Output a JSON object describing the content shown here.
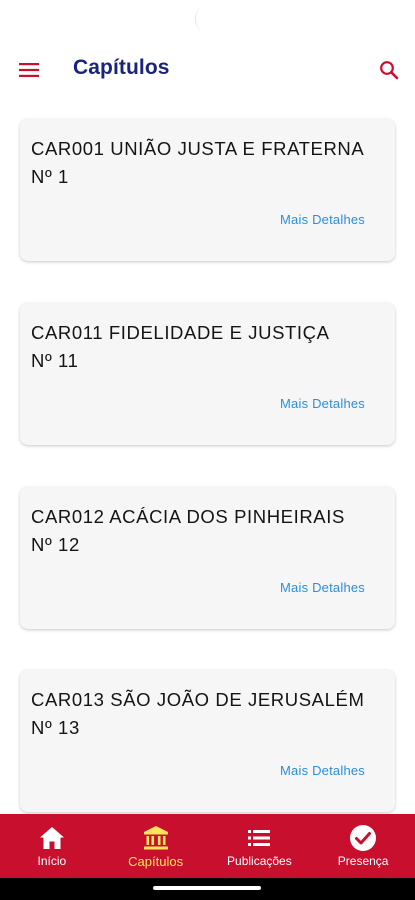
{
  "app_bar": {
    "title": "Capítulos",
    "menu_icon": "hamburger-menu-icon",
    "search_icon": "search-icon",
    "accent_color": "#c8102e",
    "title_color": "#1a237e"
  },
  "chapters": [
    {
      "title_line1": "CAR001 UNIÃO JUSTA E FRATERNA",
      "title_line2": "Nº 1",
      "details_label": "Mais Detalhes"
    },
    {
      "title_line1": "CAR011 FIDELIDADE E JUSTIÇA",
      "title_line2": "Nº 11",
      "details_label": "Mais Detalhes"
    },
    {
      "title_line1": "CAR012 ACÁCIA DOS PINHEIRAIS",
      "title_line2": "Nº 12",
      "details_label": "Mais Detalhes"
    },
    {
      "title_line1": "CAR013 SÃO JOÃO DE JERUSALÉM",
      "title_line2": "Nº 13",
      "details_label": "Mais Detalhes"
    }
  ],
  "bottom_nav": {
    "background": "#c8102e",
    "active_color": "#ffe45c",
    "items": [
      {
        "label": "Início",
        "icon": "home-icon",
        "active": false
      },
      {
        "label": "Capítulos",
        "icon": "institution-icon",
        "active": true
      },
      {
        "label": "Publicações",
        "icon": "list-icon",
        "active": false
      },
      {
        "label": "Presença",
        "icon": "check-circle-icon",
        "active": false
      }
    ]
  }
}
